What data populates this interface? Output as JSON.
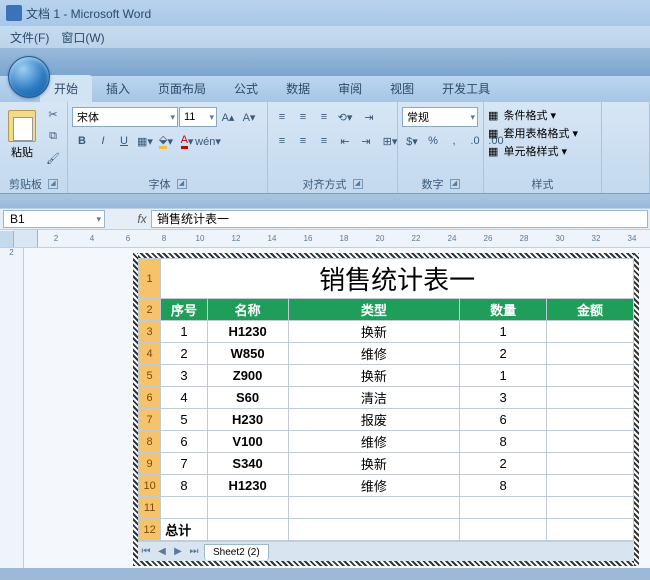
{
  "window": {
    "title": "文档 1 - Microsoft Word"
  },
  "menu": {
    "file": "文件(F)",
    "window": "窗口(W)"
  },
  "tabs": {
    "start": "开始",
    "insert": "插入",
    "layout": "页面布局",
    "formula": "公式",
    "data": "数据",
    "review": "审阅",
    "view": "视图",
    "dev": "开发工具"
  },
  "ribbon": {
    "clipboard": {
      "paste": "粘贴",
      "label": "剪贴板"
    },
    "font": {
      "name": "宋体",
      "size": "11",
      "label": "字体",
      "bold": "B",
      "italic": "I",
      "underline": "U"
    },
    "align": {
      "label": "对齐方式"
    },
    "number": {
      "format": "常规",
      "label": "数字"
    },
    "styles": {
      "label": "样式",
      "cond": "条件格式 ▾",
      "tfmt": "套用表格格式 ▾",
      "cellstyle": "单元格样式 ▾"
    }
  },
  "formula": {
    "ref": "B1",
    "fx": "fx",
    "value": "销售统计表一"
  },
  "ruler": {
    "h": [
      "2",
      "4",
      "6",
      "8",
      "10",
      "12",
      "14",
      "16",
      "18",
      "20",
      "22",
      "24",
      "26",
      "28",
      "30",
      "32",
      "34"
    ],
    "v": [
      "2"
    ]
  },
  "sheet": {
    "title": "销售统计表一",
    "headers": [
      "序号",
      "名称",
      "类型",
      "数量",
      "金额"
    ],
    "rows": [
      {
        "n": "1",
        "name": "H1230",
        "type": "换新",
        "qty": "1",
        "amt": ""
      },
      {
        "n": "2",
        "name": "W850",
        "type": "维修",
        "qty": "2",
        "amt": ""
      },
      {
        "n": "3",
        "name": "Z900",
        "type": "换新",
        "qty": "1",
        "amt": ""
      },
      {
        "n": "4",
        "name": "S60",
        "type": "清洁",
        "qty": "3",
        "amt": ""
      },
      {
        "n": "5",
        "name": "H230",
        "type": "报废",
        "qty": "6",
        "amt": ""
      },
      {
        "n": "6",
        "name": "V100",
        "type": "维修",
        "qty": "8",
        "amt": ""
      },
      {
        "n": "7",
        "name": "S340",
        "type": "换新",
        "qty": "2",
        "amt": ""
      },
      {
        "n": "8",
        "name": "H1230",
        "type": "维修",
        "qty": "8",
        "amt": ""
      }
    ],
    "total": "总计",
    "rowlabels": [
      "1",
      "2",
      "3",
      "4",
      "5",
      "6",
      "7",
      "8",
      "9",
      "10",
      "11",
      "12"
    ],
    "tabnav": [
      "⏮",
      "◀",
      "▶",
      "⏭"
    ],
    "tab": "Sheet2 (2)"
  }
}
